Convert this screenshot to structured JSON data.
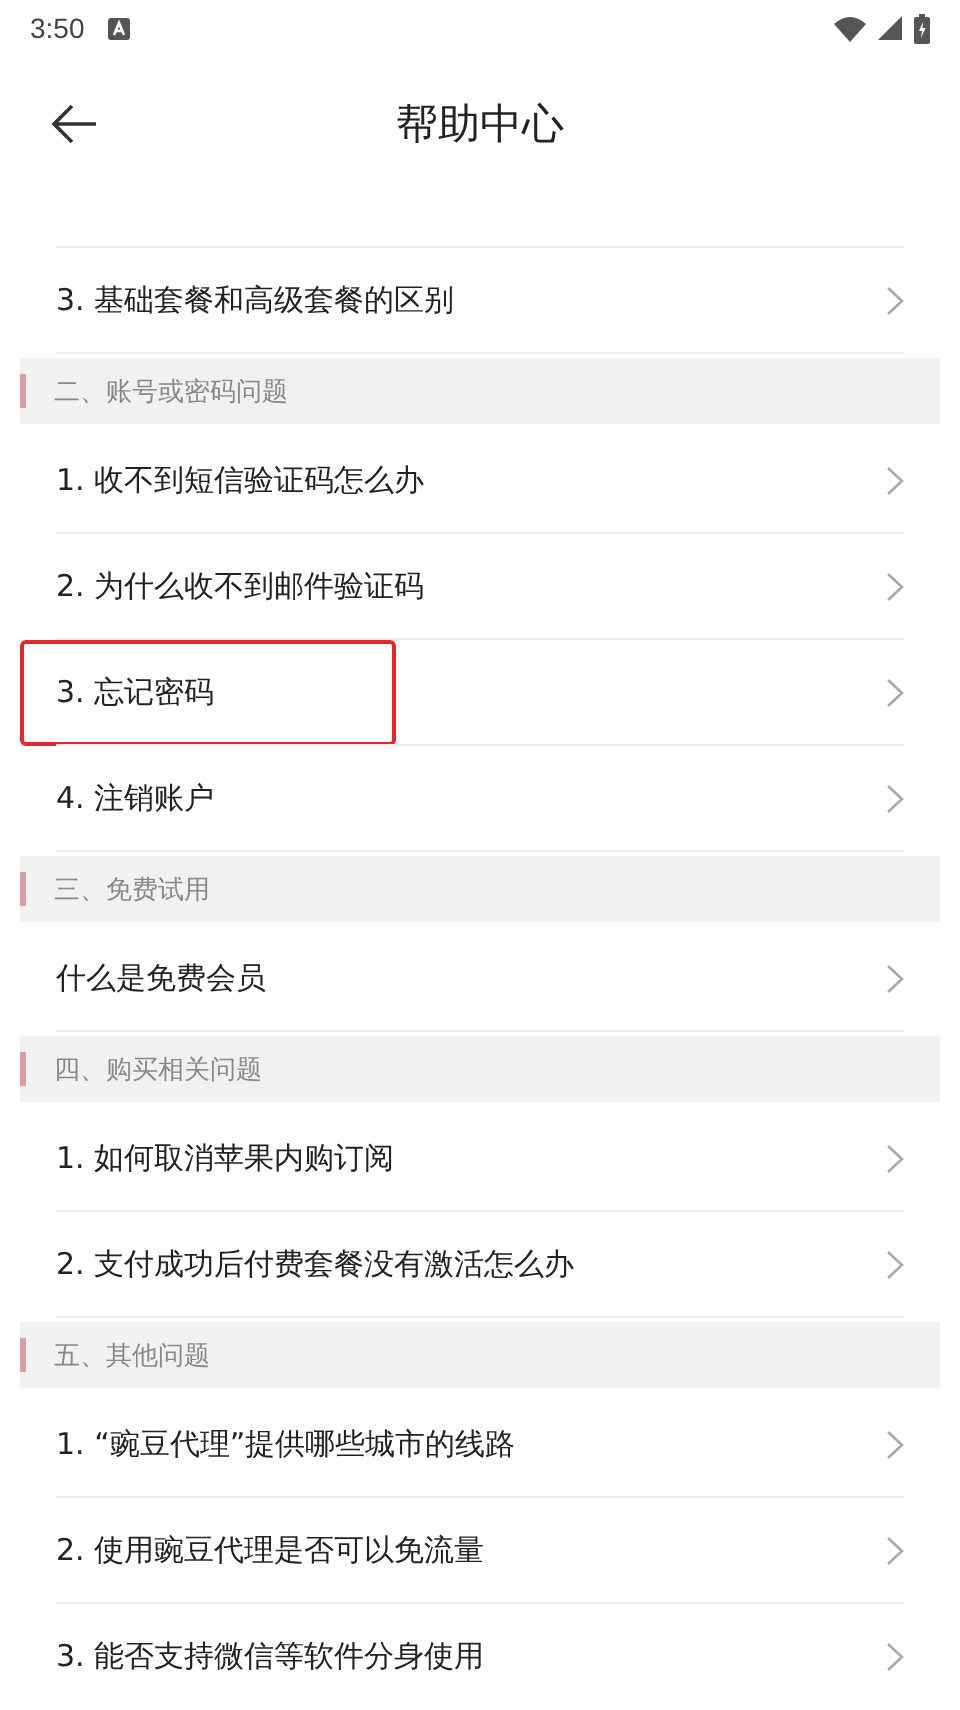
{
  "status_bar": {
    "time": "3:50"
  },
  "header": {
    "title": "帮助中心"
  },
  "sections": [
    {
      "items": [
        {
          "label": "3. 基础套餐和高级套餐的区别",
          "highlighted": false
        }
      ]
    },
    {
      "title": "二、账号或密码问题",
      "items": [
        {
          "label": "1. 收不到短信验证码怎么办",
          "highlighted": false
        },
        {
          "label": "2. 为什么收不到邮件验证码",
          "highlighted": false
        },
        {
          "label": "3. 忘记密码",
          "highlighted": true
        },
        {
          "label": "4. 注销账户",
          "highlighted": false
        }
      ]
    },
    {
      "title": "三、免费试用",
      "items": [
        {
          "label": "什么是免费会员",
          "highlighted": false
        }
      ]
    },
    {
      "title": "四、购买相关问题",
      "items": [
        {
          "label": "1. 如何取消苹果内购订阅",
          "highlighted": false
        },
        {
          "label": "2. 支付成功后付费套餐没有激活怎么办",
          "highlighted": false
        }
      ]
    },
    {
      "title": "五、其他问题",
      "items": [
        {
          "label": "1. “豌豆代理”提供哪些城市的线路",
          "highlighted": false
        },
        {
          "label": "2. 使用豌豆代理是否可以免流量",
          "highlighted": false
        },
        {
          "label": "3. 能否支持微信等软件分身使用",
          "highlighted": false
        }
      ]
    }
  ]
}
